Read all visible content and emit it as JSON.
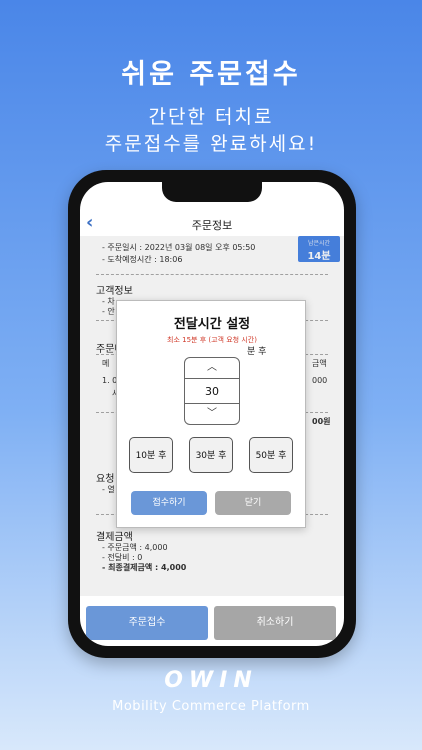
{
  "promo": {
    "headline": "쉬운 주문접수",
    "sub_line1": "간단한 터치로",
    "sub_line2": "주문접수를 완료하세요!",
    "logo": "OWIN",
    "tagline": "Mobility Commerce Platform"
  },
  "app": {
    "nav": {
      "back_icon": "chevron-left-icon",
      "back": "‹",
      "title": "주문정보"
    },
    "order": {
      "order_time": "- 주문일시 : 2022년 03월 08일 오후 05:50",
      "arrival_time": "- 도착예정시간 : 18:06",
      "badge_top": "남은시간",
      "badge_value": "14분"
    },
    "customer": {
      "section": "고객정보",
      "line1": "- 차",
      "line2": "- 안"
    },
    "order_detail": {
      "section": "주문내",
      "col": "메",
      "col_amount": "금액",
      "item": "1. 0",
      "item_sub": "사",
      "item_amount": "000",
      "total_suffix": "00원"
    },
    "request": {
      "section": "요청",
      "line": "- 열"
    },
    "payment": {
      "section": "결제금액",
      "order_amount": "- 주문금액 : 4,000",
      "delivery_fee": "- 전달비 : 0",
      "final_amount": "- 최종결제금액 : 4,000"
    },
    "modal": {
      "title": "전달시간 설정",
      "note": "최소 15분 후 (고객 요청 시간)",
      "unit": "분 후",
      "up": "︿",
      "value": "30",
      "down": "﹀",
      "quick": [
        "10분 후",
        "30분 후",
        "50분 후"
      ],
      "accept": "접수하기",
      "close": "닫기"
    },
    "bottom": {
      "accept": "주문접수",
      "cancel": "취소하기"
    }
  }
}
